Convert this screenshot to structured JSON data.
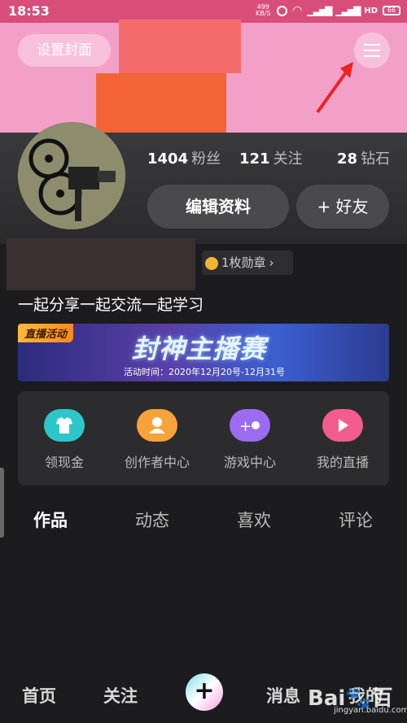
{
  "status_bar": {
    "time": "18:53",
    "net_speed": "499\nKB/S",
    "battery": "66"
  },
  "cover": {
    "set_cover_label": "设置封面"
  },
  "profile": {
    "stats": [
      {
        "value": "1404",
        "label": "粉丝"
      },
      {
        "value": "121",
        "label": "关注"
      },
      {
        "value": "28",
        "label": "钻石"
      }
    ],
    "edit_label": "编辑资料",
    "add_friend_label": "+ 好友",
    "medal_label": "1枚勋章",
    "bio": "一起分享一起交流一起学习"
  },
  "banner": {
    "tag": "直播活动",
    "title": "封神主播赛",
    "date": "活动时间：2020年12月20号-12月31号"
  },
  "shortcuts": [
    {
      "label": "领现金",
      "color": "#2ec7c9",
      "icon": "shirt-icon"
    },
    {
      "label": "创作者中心",
      "color": "#f7a23b",
      "icon": "person-icon"
    },
    {
      "label": "游戏中心",
      "color": "#9b6bf0",
      "icon": "gamepad-icon"
    },
    {
      "label": "我的直播",
      "color": "#f25d8e",
      "icon": "play-icon"
    }
  ],
  "tabs": [
    "作品",
    "动态",
    "喜欢",
    "评论"
  ],
  "bottom_nav": [
    "首页",
    "关注",
    "消息",
    "我的"
  ],
  "plus_label": "+",
  "watermark": {
    "text": "Bai🐾百",
    "sub": "jingyan.baidu.com"
  }
}
